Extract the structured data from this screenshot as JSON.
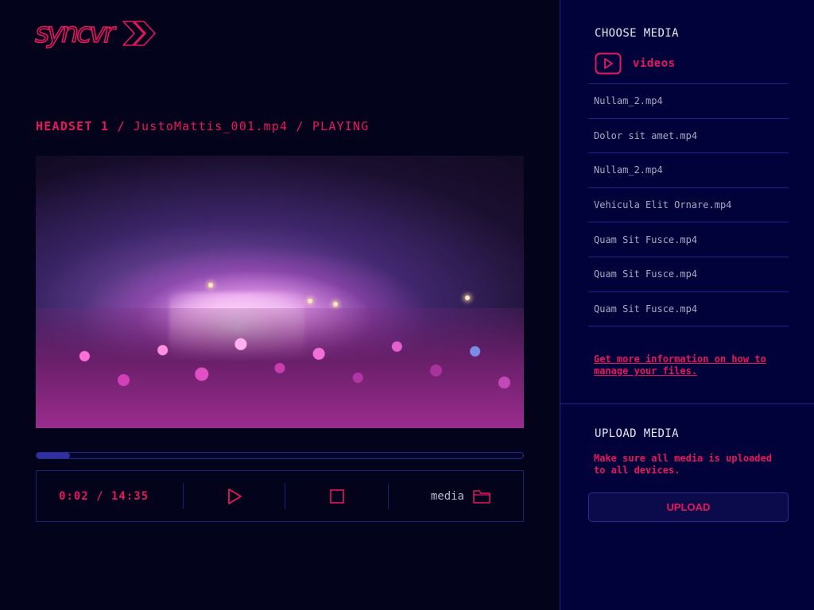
{
  "brand": {
    "logo_text": "syncvr"
  },
  "player": {
    "headset": "HEADSET 1",
    "separator": "/",
    "filename": "JustoMattis_001.mp4",
    "state": "PLAYING",
    "progress_fraction": 0.068,
    "time_display": "0:02 / 14:35",
    "media_label": "media"
  },
  "panel": {
    "choose_title": "CHOOSE MEDIA",
    "videos_label": "videos",
    "files": [
      "Nullam_2.mp4",
      "Dolor sit amet.mp4",
      "Nullam_2.mp4",
      "Vehicula Elit Ornare.mp4",
      "Quam Sit Fusce.mp4",
      "Quam Sit Fusce.mp4",
      "Quam Sit Fusce.mp4"
    ],
    "info_link": "Get more information on how to manage your files.",
    "upload_title": "UPLOAD MEDIA",
    "upload_note": "Make sure all media is uploaded to all devices.",
    "upload_button": "UPLOAD"
  },
  "colors": {
    "accent": "#e8165c",
    "background": "#04031c",
    "panel": "#02023a",
    "border": "#24248a"
  },
  "icons": {
    "logo": "double-chevron-right-icon",
    "videos": "play-square-icon",
    "play": "play-icon",
    "stop": "stop-icon",
    "media": "folder-icon"
  }
}
